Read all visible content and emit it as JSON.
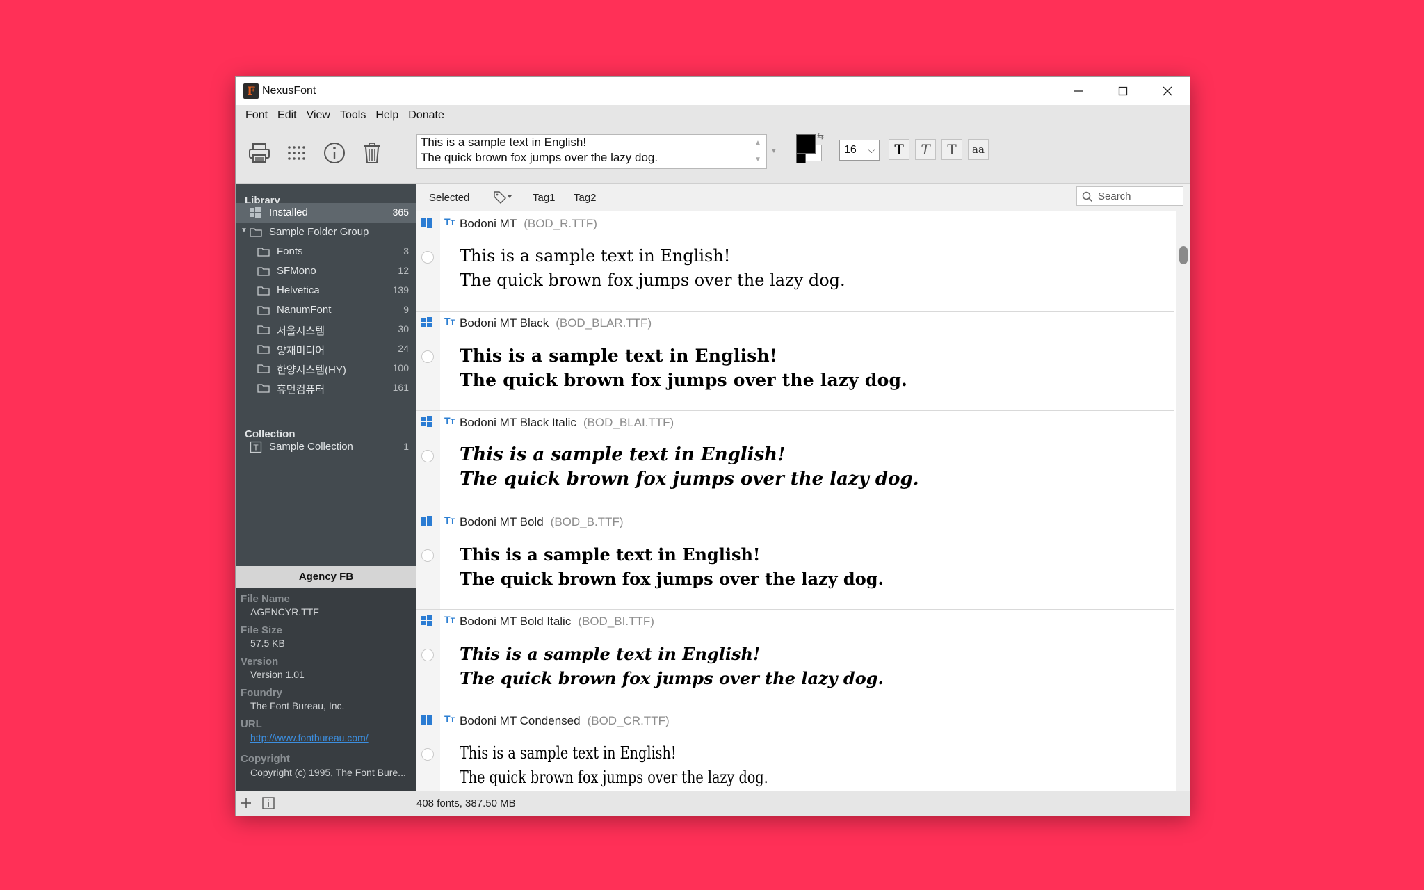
{
  "window": {
    "title": "NexusFont"
  },
  "menu": [
    "Font",
    "Edit",
    "View",
    "Tools",
    "Help",
    "Donate"
  ],
  "toolbar": {
    "sample_lines": [
      "This is a sample text in English!",
      "The quick brown fox jumps over the lazy dog."
    ],
    "font_size": "16",
    "style_buttons": [
      "T",
      "T",
      "T",
      "aa"
    ],
    "fg_color": "#000000",
    "bg_color": "#ffffff"
  },
  "sidebar": {
    "library_label": "Library",
    "installed": {
      "label": "Installed",
      "count": "365"
    },
    "group": {
      "label": "Sample Folder Group"
    },
    "folders": [
      {
        "label": "Fonts",
        "count": "3"
      },
      {
        "label": "SFMono",
        "count": "12"
      },
      {
        "label": "Helvetica",
        "count": "139"
      },
      {
        "label": "NanumFont",
        "count": "9"
      },
      {
        "label": "서울시스템",
        "count": "30"
      },
      {
        "label": "양재미디어",
        "count": "24"
      },
      {
        "label": "한양시스템(HY)",
        "count": "100"
      },
      {
        "label": "휴먼컴퓨터",
        "count": "161"
      }
    ],
    "collection_label": "Collection",
    "collection": {
      "label": "Sample Collection",
      "count": "1"
    }
  },
  "info": {
    "font_title": "Agency FB",
    "fields": [
      {
        "label": "File Name",
        "value": "AGENCYR.TTF"
      },
      {
        "label": "File Size",
        "value": "57.5 KB"
      },
      {
        "label": "Version",
        "value": "Version 1.01"
      },
      {
        "label": "Foundry",
        "value": "The Font Bureau, Inc."
      },
      {
        "label": "URL",
        "value": "http://www.fontbureau.com/"
      },
      {
        "label": "Copyright",
        "value": "Copyright (c) 1995, The Font Bure..."
      }
    ]
  },
  "tagbar": {
    "selected": "Selected",
    "tags": [
      "Tag1",
      "Tag2"
    ],
    "search_placeholder": "Search"
  },
  "fonts": [
    {
      "name": "Bodoni MT",
      "file": "(BOD_R.TTF)",
      "preview": [
        "This is a sample text in English!",
        "The quick brown fox jumps over the lazy dog."
      ]
    },
    {
      "name": "Bodoni MT Black",
      "file": "(BOD_BLAR.TTF)",
      "preview": [
        "This is a sample text in English!",
        "The quick brown fox jumps over the lazy dog."
      ]
    },
    {
      "name": "Bodoni MT Black Italic",
      "file": "(BOD_BLAI.TTF)",
      "preview": [
        "This is a sample text in English!",
        "The quick brown fox jumps over the lazy dog."
      ]
    },
    {
      "name": "Bodoni MT Bold",
      "file": "(BOD_B.TTF)",
      "preview": [
        "This is a sample text in English!",
        "The quick brown fox jumps over the lazy dog."
      ]
    },
    {
      "name": "Bodoni MT Bold Italic",
      "file": "(BOD_BI.TTF)",
      "preview": [
        "This is a sample text in English!",
        "The quick brown fox jumps over the lazy dog."
      ]
    },
    {
      "name": "Bodoni MT Condensed",
      "file": "(BOD_CR.TTF)",
      "preview": [
        "This is a sample text in English!",
        "The quick brown fox jumps over the lazy dog."
      ]
    }
  ],
  "status": {
    "text": "408 fonts, 387.50 MB"
  }
}
